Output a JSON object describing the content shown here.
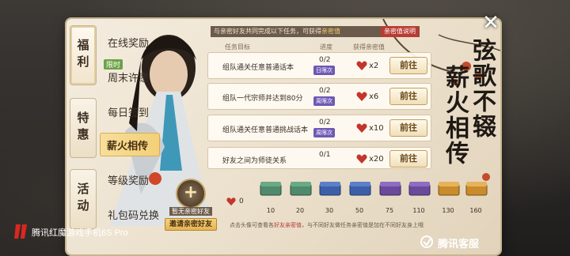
{
  "category_tabs": [
    {
      "label": "福利"
    },
    {
      "label": "特惠"
    },
    {
      "label": "活动"
    }
  ],
  "menu": {
    "items": [
      {
        "label": "在线奖励"
      },
      {
        "label": "周末许愿",
        "tag": "限时"
      },
      {
        "label": "每日签到"
      },
      {
        "label": "薪火相传"
      },
      {
        "label": "等级奖励"
      },
      {
        "label": "礼包码兑换"
      }
    ]
  },
  "header": {
    "note": "与亲密好友共同完成以下任务，可获得",
    "note_hl": "亲密值",
    "help_button": "亲密值说明"
  },
  "table": {
    "col_target": "任务目标",
    "col_progress": "进度",
    "col_reward": "获得亲密值"
  },
  "tasks": [
    {
      "name": "组队通关任意普通话本",
      "progress": "0/2",
      "badge": "日限次",
      "reward": "x2",
      "button": "前往"
    },
    {
      "name": "组队一代宗师并达到80分",
      "progress": "0/2",
      "badge": "周限次",
      "reward": "x6",
      "button": "前往"
    },
    {
      "name": "组队通关任意普通挑战话本",
      "progress": "0/2",
      "badge": "周限次",
      "reward": "x10",
      "button": "前往"
    },
    {
      "name": "好友之间为师徒关系",
      "progress": "0/1",
      "badge": "",
      "reward": "x20",
      "button": "前往"
    }
  ],
  "side_title": {
    "line1": "弦歌不辍",
    "line2": "薪火相传"
  },
  "bottom": {
    "circle_plus": "+",
    "label": "暂无亲密好友",
    "invite_button": "邀请亲密好友",
    "score": "0",
    "milestones": [
      "10",
      "20",
      "30",
      "50",
      "75",
      "110",
      "130",
      "160"
    ],
    "foot_pre": "点击头像可查看各",
    "foot_hl": "好友亲密值",
    "foot_post": "，与不同好友做任务亲密值是加在不同好友身上哦"
  },
  "close_label": "✕",
  "watermark": {
    "left": "腾讯红魔游戏手机6S Pro",
    "right": "腾讯客服"
  },
  "colors": {
    "accent_gold": "#f3cf78",
    "heart_red": "#c2362d",
    "badge_purple": "#6e58b5"
  }
}
